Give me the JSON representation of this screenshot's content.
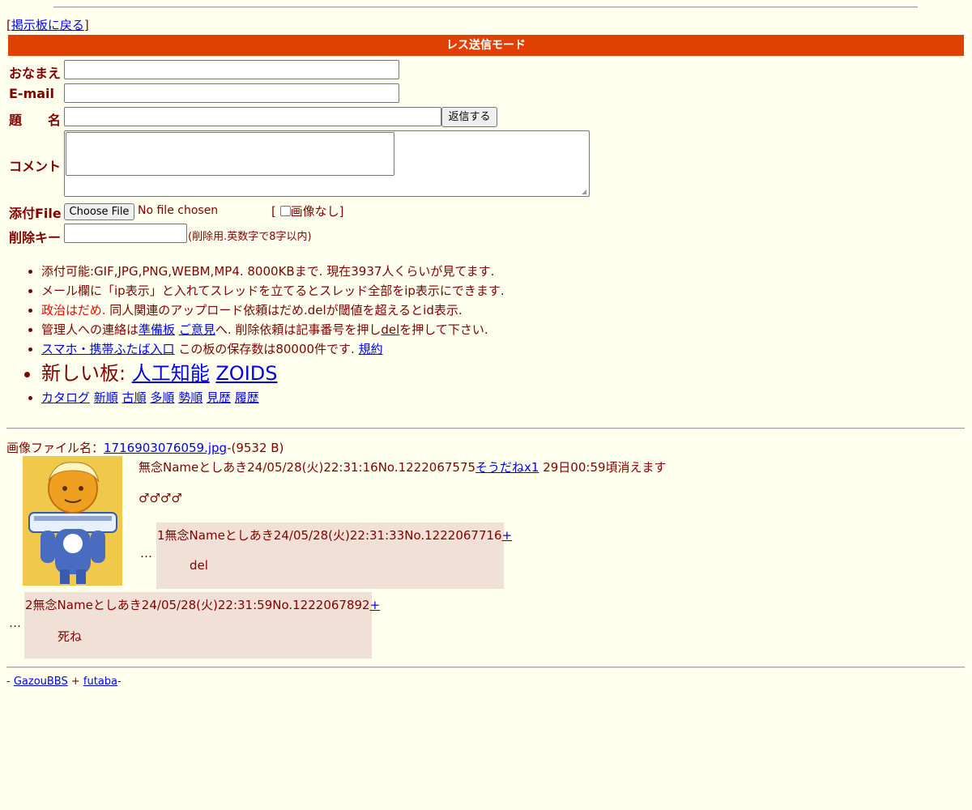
{
  "nav": {
    "back_open": "[",
    "back_link": "掲示板に戻る",
    "back_close": "]"
  },
  "mode_title": "レス送信モード",
  "form": {
    "name_label": "おなまえ",
    "email_label": "E-mail",
    "subject_label": "題　　名",
    "submit_label": "返信する",
    "comment_label": "コメント",
    "file_label": "添付File",
    "file_button": "Choose File",
    "file_status": "No file chosen",
    "noimage_open": "[",
    "noimage_label": "画像なし",
    "noimage_close": "]",
    "delkey_label": "削除キー",
    "delkey_hint": "(削除用.英数字で8字以内)"
  },
  "rules": {
    "line1": "添付可能:GIF,JPG,PNG,WEBM,MP4. 8000KBまで. 現在3937人くらいが見てます.",
    "line2": "メール欄に「ip表示」と入れてスレッドを立てるとスレッド全部をip表示にできます.",
    "line3_red": "政治はだめ.",
    "line3_rest": " 同人関連のアップロード依頼はだめ.delが閾値を超えるとid表示.",
    "line4_a": "管理人への連絡は",
    "line4_link1": "準備板",
    "line4_link2": "ご意見",
    "line4_b": "へ. 削除依頼は記事番号を押し",
    "line4_link3": "del",
    "line4_c": "を押して下さい.",
    "line5_link": "スマホ・携帯ふたば入口",
    "line5_text": " この板の保存数は80000件です. ",
    "line5_link2": "規約",
    "line6_text": "新しい板: ",
    "line6_link1": "人工知能",
    "line6_link2": "ZOIDS",
    "sort_links": [
      "カタログ",
      "新順",
      "古順",
      "多順",
      "勢順",
      "見歴",
      "履歴"
    ]
  },
  "thread": {
    "file_prefix": "画像ファイル名：",
    "file_name": "1716903076059.jpg",
    "file_size": "-(9532 B)",
    "op_header": "無念Nameとしあき24/05/28(火)22:31:16No.1222067575",
    "op_soudane": "そうだねx1",
    "op_expire": " 29日00:59頃消えます",
    "op_body": "♂♂♂♂",
    "replies": [
      {
        "marker": "…",
        "header": "1無念Nameとしあき24/05/28(火)22:31:33No.1222067716",
        "plus": "+",
        "body": "del"
      },
      {
        "marker": "…",
        "header": "2無念Nameとしあき24/05/28(火)22:31:59No.1222067892",
        "plus": "+",
        "body": "死ね"
      }
    ]
  },
  "footer": {
    "prefix": "- ",
    "link1": "GazouBBS",
    "mid": " + ",
    "link2": "futaba",
    "suffix": "-"
  },
  "colors": {
    "background": "#ffffee",
    "text": "#800000",
    "mode_bar": "#e04000",
    "reply_bg": "#f0e0d6",
    "link": "#0000ee"
  }
}
